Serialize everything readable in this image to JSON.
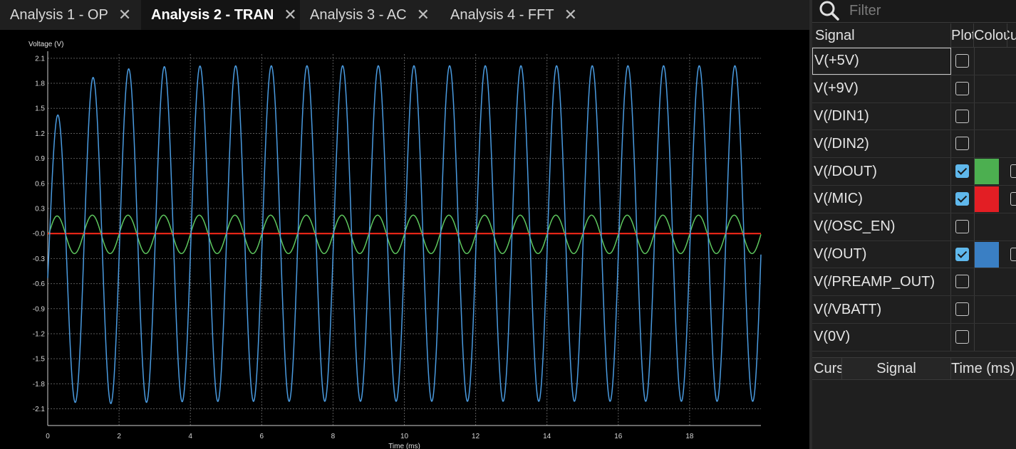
{
  "tabs": [
    {
      "label": "Analysis 1 - OP",
      "active": false
    },
    {
      "label": "Analysis 2 - TRAN",
      "active": true
    },
    {
      "label": "Analysis 3 - AC",
      "active": false
    },
    {
      "label": "Analysis 4 - FFT",
      "active": false
    }
  ],
  "filter": {
    "placeholder": "Filter",
    "value": ""
  },
  "signals_table": {
    "headers": {
      "signal": "Signal",
      "plot": "Plot",
      "colour": "Colour",
      "cursor": "Cursor"
    },
    "rows": [
      {
        "name": "V(+5V)",
        "plot": false,
        "colour": null,
        "selected": true
      },
      {
        "name": "V(+9V)",
        "plot": false,
        "colour": null
      },
      {
        "name": "V(/DIN1)",
        "plot": false,
        "colour": null
      },
      {
        "name": "V(/DIN2)",
        "plot": false,
        "colour": null
      },
      {
        "name": "V(/DOUT)",
        "plot": true,
        "colour": "#4caf50"
      },
      {
        "name": "V(/MIC)",
        "plot": true,
        "colour": "#e31e24"
      },
      {
        "name": "V(/OSC_EN)",
        "plot": false,
        "colour": null
      },
      {
        "name": "V(/OUT)",
        "plot": true,
        "colour": "#3a7fc4"
      },
      {
        "name": "V(/PREAMP_OUT)",
        "plot": false,
        "colour": null
      },
      {
        "name": "V(/VBATT)",
        "plot": false,
        "colour": null
      },
      {
        "name": "V(0V)",
        "plot": false,
        "colour": null
      }
    ]
  },
  "cursors_table": {
    "headers": {
      "cursor": "Cursor",
      "signal": "Signal",
      "time": "Time (ms)"
    }
  },
  "chart_data": {
    "type": "line",
    "ylabel": "Voltage (V)",
    "xlabel": "Time (ms)",
    "xlim": [
      0,
      20
    ],
    "ylim": [
      -2.3,
      2.15
    ],
    "yticks": [
      "2.1",
      "1.8",
      "1.5",
      "1.2",
      "0.9",
      "0.6",
      "0.3",
      "-0.0",
      "-0.3",
      "-0.6",
      "-0.9",
      "-1.2",
      "-1.5",
      "-1.8",
      "-2.1"
    ],
    "xticks": [
      "0",
      "2",
      "4",
      "6",
      "8",
      "10",
      "12",
      "14",
      "16",
      "18"
    ],
    "grid": true,
    "series": [
      {
        "name": "V(/OUT)",
        "color": "#4a9be0",
        "x": [
          0.0,
          0.27,
          0.78,
          1.26,
          1.98,
          2.3,
          3.3,
          4.3,
          5.3,
          6.3,
          7.3,
          8.3,
          9.3,
          10.3,
          11.3,
          12.3,
          13.3,
          14.3,
          15.3,
          16.3,
          17.3,
          18.3,
          19.3,
          20.0
        ],
        "y": [
          0.0,
          1.62,
          -2.2,
          1.86,
          -2.04,
          1.97,
          2.01,
          2.01,
          2.01,
          2.01,
          2.01,
          2.01,
          2.01,
          2.01,
          2.01,
          2.01,
          2.01,
          2.01,
          2.01,
          2.01,
          2.01,
          2.01,
          2.01,
          -0.25
        ]
      },
      {
        "name": "V(/DOUT)",
        "color": "#5ec75e",
        "x": [
          0.0,
          0.25,
          0.75,
          20.0
        ],
        "y": [
          0.0,
          0.22,
          -0.24,
          -0.05
        ]
      },
      {
        "name": "V(/MIC)",
        "color": "#ff2a1a",
        "x": [
          0.0,
          20.0
        ],
        "y": [
          0.0,
          0.0
        ]
      }
    ],
    "signal_frequency_khz": 1.0
  }
}
